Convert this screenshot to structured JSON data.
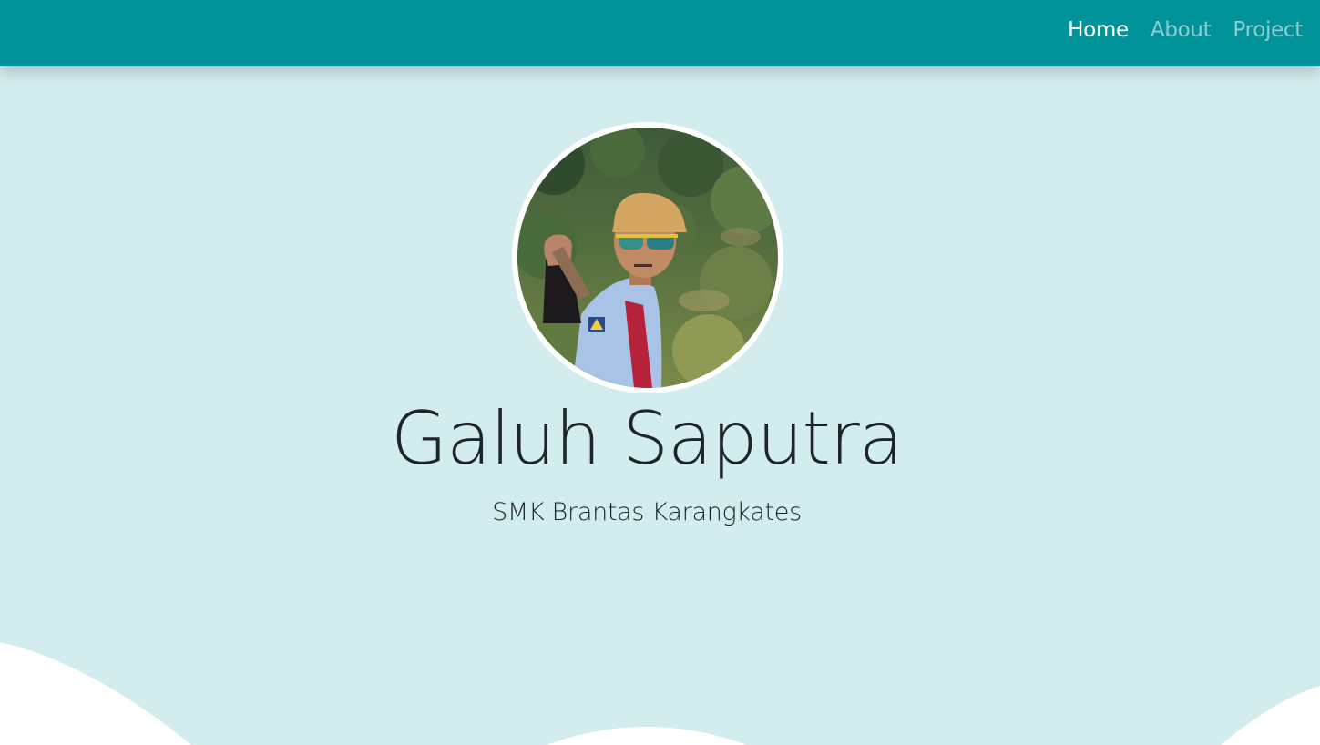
{
  "navbar": {
    "links": [
      {
        "label": "Home",
        "active": true
      },
      {
        "label": "About",
        "active": false
      },
      {
        "label": "Project",
        "active": false
      }
    ]
  },
  "hero": {
    "name": "Galuh Saputra",
    "school": "SMK Brantas Karangkates",
    "avatar_icon": "profile-photo"
  },
  "colors": {
    "navbar_bg": "#009399",
    "hero_bg": "#d3ecee",
    "wave": "#ffffff",
    "text": "#1d242b"
  }
}
